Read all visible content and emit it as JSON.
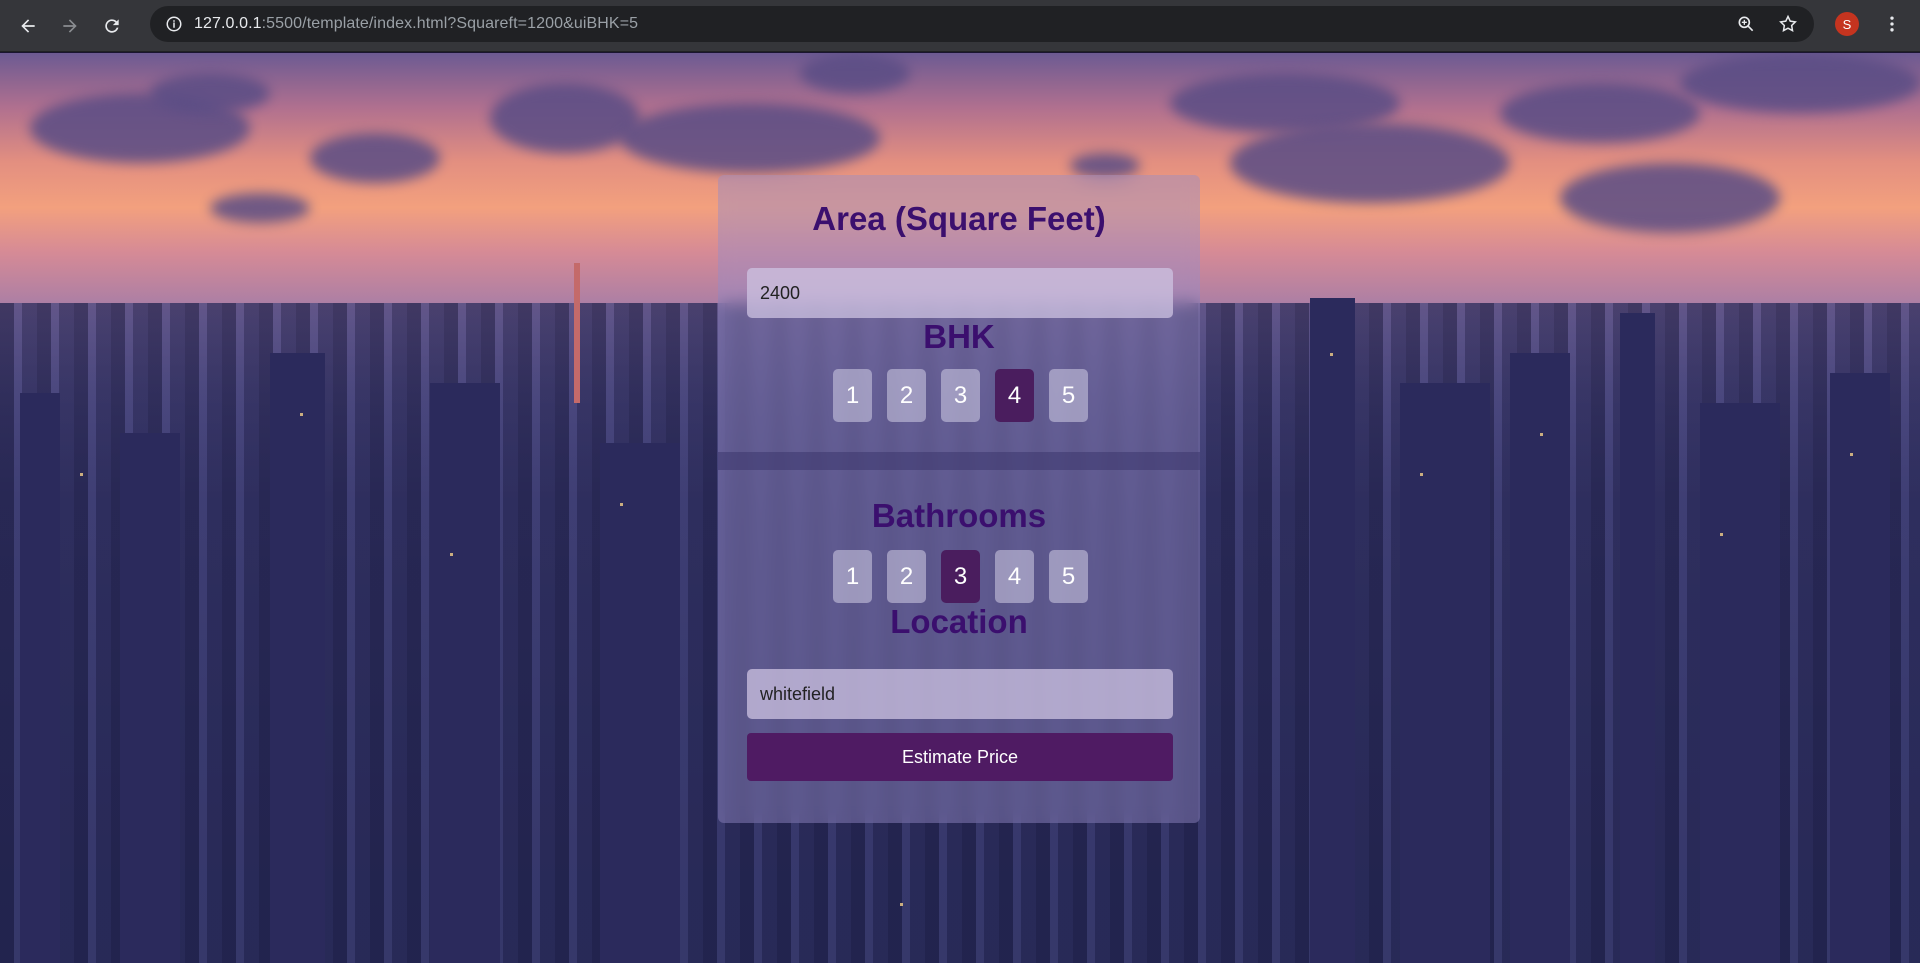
{
  "browser": {
    "url_host": "127.0.0.1",
    "url_rest": ":5500/template/index.html?Squareft=1200&uiBHK=5",
    "profile_initial": "S"
  },
  "form": {
    "area": {
      "title": "Area (Square Feet)",
      "value": "2400"
    },
    "bhk": {
      "title": "BHK",
      "options": [
        "1",
        "2",
        "3",
        "4",
        "5"
      ],
      "selected": "4"
    },
    "bathrooms": {
      "title": "Bathrooms",
      "options": [
        "1",
        "2",
        "3",
        "4",
        "5"
      ],
      "selected": "3"
    },
    "location": {
      "title": "Location",
      "value": "whitefield"
    },
    "submit_label": "Estimate Price"
  },
  "colors": {
    "title_purple": "#3b0f6e",
    "selected_option": "#4a1d5e",
    "button_bg": "#4f1b63"
  }
}
